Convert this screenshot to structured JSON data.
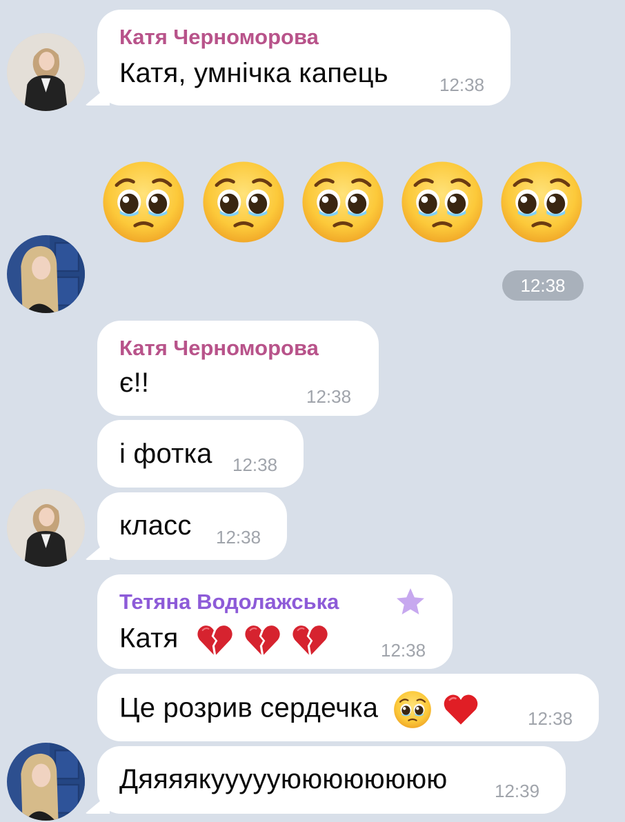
{
  "messages": [
    {
      "sender": "Катя Черноморова",
      "text": "Катя, умнічка капець",
      "time": "12:38"
    },
    {
      "emoji": "pleading-face",
      "count": 5,
      "time": "12:38"
    },
    {
      "sender": "Катя Черноморова",
      "text": "є!!",
      "time": "12:38"
    },
    {
      "text": "і фотка",
      "time": "12:38"
    },
    {
      "text": "класс",
      "time": "12:38"
    },
    {
      "sender": "Тетяна Водолажська",
      "text": "Катя",
      "emoji": "broken-heart",
      "time": "12:38"
    },
    {
      "text": "Це розрив сердечка",
      "emoji": [
        "pleading-face",
        "red-heart"
      ],
      "time": "12:38"
    },
    {
      "text": "Дяяяякуууууюююююююю",
      "time": "12:39"
    }
  ],
  "colors": {
    "background": "#d8dfe9",
    "bubble": "#ffffff",
    "sender_katya": "#b8538a",
    "sender_tetiana": "#8d5bd8",
    "time": "#a0a4ab",
    "time_pill": "#a9b1bb"
  }
}
